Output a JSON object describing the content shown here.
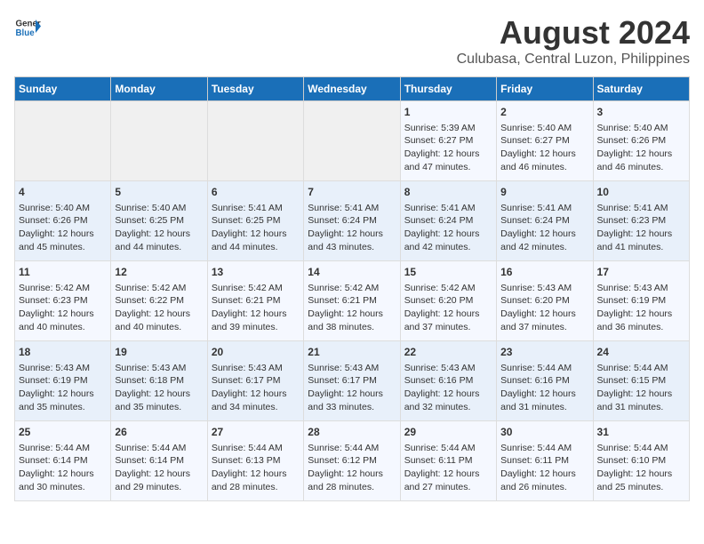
{
  "header": {
    "logo_line1": "General",
    "logo_line2": "Blue",
    "title": "August 2024",
    "subtitle": "Culubasa, Central Luzon, Philippines"
  },
  "calendar": {
    "days_of_week": [
      "Sunday",
      "Monday",
      "Tuesday",
      "Wednesday",
      "Thursday",
      "Friday",
      "Saturday"
    ],
    "weeks": [
      [
        {
          "day": "",
          "content": ""
        },
        {
          "day": "",
          "content": ""
        },
        {
          "day": "",
          "content": ""
        },
        {
          "day": "",
          "content": ""
        },
        {
          "day": "1",
          "content": "Sunrise: 5:39 AM\nSunset: 6:27 PM\nDaylight: 12 hours\nand 47 minutes."
        },
        {
          "day": "2",
          "content": "Sunrise: 5:40 AM\nSunset: 6:27 PM\nDaylight: 12 hours\nand 46 minutes."
        },
        {
          "day": "3",
          "content": "Sunrise: 5:40 AM\nSunset: 6:26 PM\nDaylight: 12 hours\nand 46 minutes."
        }
      ],
      [
        {
          "day": "4",
          "content": "Sunrise: 5:40 AM\nSunset: 6:26 PM\nDaylight: 12 hours\nand 45 minutes."
        },
        {
          "day": "5",
          "content": "Sunrise: 5:40 AM\nSunset: 6:25 PM\nDaylight: 12 hours\nand 44 minutes."
        },
        {
          "day": "6",
          "content": "Sunrise: 5:41 AM\nSunset: 6:25 PM\nDaylight: 12 hours\nand 44 minutes."
        },
        {
          "day": "7",
          "content": "Sunrise: 5:41 AM\nSunset: 6:24 PM\nDaylight: 12 hours\nand 43 minutes."
        },
        {
          "day": "8",
          "content": "Sunrise: 5:41 AM\nSunset: 6:24 PM\nDaylight: 12 hours\nand 42 minutes."
        },
        {
          "day": "9",
          "content": "Sunrise: 5:41 AM\nSunset: 6:24 PM\nDaylight: 12 hours\nand 42 minutes."
        },
        {
          "day": "10",
          "content": "Sunrise: 5:41 AM\nSunset: 6:23 PM\nDaylight: 12 hours\nand 41 minutes."
        }
      ],
      [
        {
          "day": "11",
          "content": "Sunrise: 5:42 AM\nSunset: 6:23 PM\nDaylight: 12 hours\nand 40 minutes."
        },
        {
          "day": "12",
          "content": "Sunrise: 5:42 AM\nSunset: 6:22 PM\nDaylight: 12 hours\nand 40 minutes."
        },
        {
          "day": "13",
          "content": "Sunrise: 5:42 AM\nSunset: 6:21 PM\nDaylight: 12 hours\nand 39 minutes."
        },
        {
          "day": "14",
          "content": "Sunrise: 5:42 AM\nSunset: 6:21 PM\nDaylight: 12 hours\nand 38 minutes."
        },
        {
          "day": "15",
          "content": "Sunrise: 5:42 AM\nSunset: 6:20 PM\nDaylight: 12 hours\nand 37 minutes."
        },
        {
          "day": "16",
          "content": "Sunrise: 5:43 AM\nSunset: 6:20 PM\nDaylight: 12 hours\nand 37 minutes."
        },
        {
          "day": "17",
          "content": "Sunrise: 5:43 AM\nSunset: 6:19 PM\nDaylight: 12 hours\nand 36 minutes."
        }
      ],
      [
        {
          "day": "18",
          "content": "Sunrise: 5:43 AM\nSunset: 6:19 PM\nDaylight: 12 hours\nand 35 minutes."
        },
        {
          "day": "19",
          "content": "Sunrise: 5:43 AM\nSunset: 6:18 PM\nDaylight: 12 hours\nand 35 minutes."
        },
        {
          "day": "20",
          "content": "Sunrise: 5:43 AM\nSunset: 6:17 PM\nDaylight: 12 hours\nand 34 minutes."
        },
        {
          "day": "21",
          "content": "Sunrise: 5:43 AM\nSunset: 6:17 PM\nDaylight: 12 hours\nand 33 minutes."
        },
        {
          "day": "22",
          "content": "Sunrise: 5:43 AM\nSunset: 6:16 PM\nDaylight: 12 hours\nand 32 minutes."
        },
        {
          "day": "23",
          "content": "Sunrise: 5:44 AM\nSunset: 6:16 PM\nDaylight: 12 hours\nand 31 minutes."
        },
        {
          "day": "24",
          "content": "Sunrise: 5:44 AM\nSunset: 6:15 PM\nDaylight: 12 hours\nand 31 minutes."
        }
      ],
      [
        {
          "day": "25",
          "content": "Sunrise: 5:44 AM\nSunset: 6:14 PM\nDaylight: 12 hours\nand 30 minutes."
        },
        {
          "day": "26",
          "content": "Sunrise: 5:44 AM\nSunset: 6:14 PM\nDaylight: 12 hours\nand 29 minutes."
        },
        {
          "day": "27",
          "content": "Sunrise: 5:44 AM\nSunset: 6:13 PM\nDaylight: 12 hours\nand 28 minutes."
        },
        {
          "day": "28",
          "content": "Sunrise: 5:44 AM\nSunset: 6:12 PM\nDaylight: 12 hours\nand 28 minutes."
        },
        {
          "day": "29",
          "content": "Sunrise: 5:44 AM\nSunset: 6:11 PM\nDaylight: 12 hours\nand 27 minutes."
        },
        {
          "day": "30",
          "content": "Sunrise: 5:44 AM\nSunset: 6:11 PM\nDaylight: 12 hours\nand 26 minutes."
        },
        {
          "day": "31",
          "content": "Sunrise: 5:44 AM\nSunset: 6:10 PM\nDaylight: 12 hours\nand 25 minutes."
        }
      ]
    ]
  }
}
